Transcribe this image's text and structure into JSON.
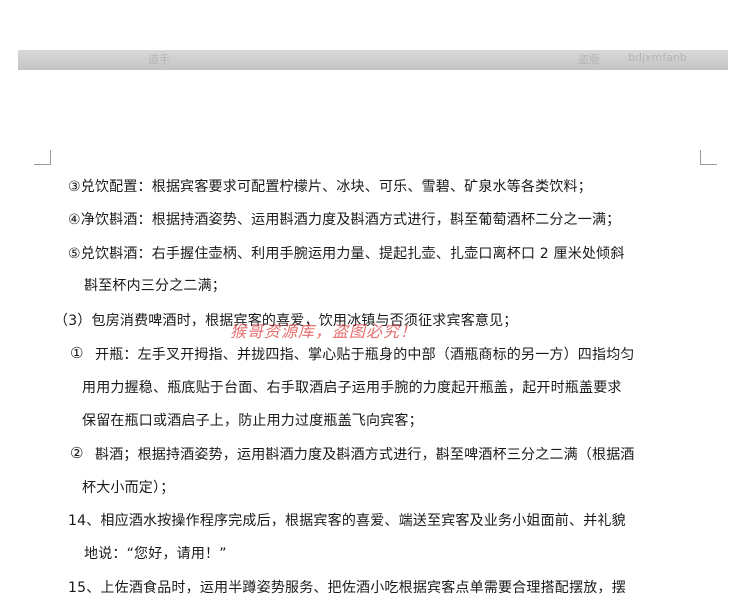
{
  "header_watermarks": [
    "道手",
    "盗版",
    "bdjxmfanb"
  ],
  "overlay_watermark": "猴哥资源库，盗图必究！",
  "lines": [
    "③兑饮配置：根据宾客要求可配置柠檬片、冰块、可乐、雪碧、矿泉水等各类饮料；",
    "④净饮斟酒：根据持酒姿势、运用斟酒力度及斟酒方式进行，斟至葡萄酒杯二分之一满；",
    "⑤兑饮斟酒：右手握住壶柄、利用手腕运用力量、提起扎壶、扎壶口离杯口 2 厘米处倾斜",
    "斟至杯内三分之二满；",
    "（3）包房消费啤酒时，根据宾客的喜爱，饮用冰镇与否须征求宾客意见；",
    "①",
    "开瓶：左手叉开拇指、并拢四指、掌心贴于瓶身的中部（酒瓶商标的另一方）四指均匀",
    "用用力握稳、瓶底贴于台面、右手取酒启子运用手腕的力度起开瓶盖，起开时瓶盖要求",
    "保留在瓶口或酒启子上，防止用力过度瓶盖飞向宾客；",
    "②",
    "斟酒；根据持酒姿势，运用斟酒力度及斟酒方式进行，斟至啤酒杯三分之二满（根据酒",
    "杯大小而定）；",
    "14、相应酒水按操作程序完成后，根据宾客的喜爱、端送至宾客及业务小姐面前、并礼貌",
    "地说：“您好，请用！”",
    "15、上佐酒食品时，运用半蹲姿势服务、把佐酒小吃根据宾客点单需要合理搭配摆放，摆"
  ]
}
